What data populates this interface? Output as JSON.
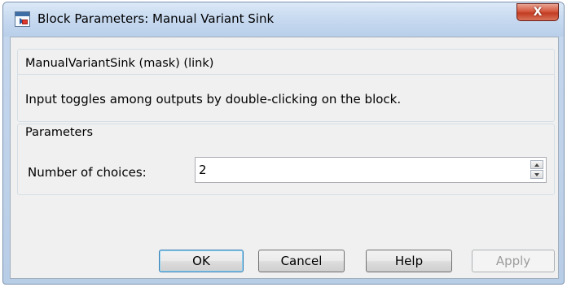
{
  "window": {
    "title": "Block Parameters: Manual Variant Sink",
    "close_symbol": "X"
  },
  "mask": {
    "title": "ManualVariantSink (mask) (link)",
    "description": "Input toggles among outputs by double-clicking on the block."
  },
  "parameters": {
    "title": "Parameters",
    "number_of_choices_label": "Number of choices:",
    "number_of_choices_value": "2"
  },
  "buttons": {
    "ok": "OK",
    "cancel": "Cancel",
    "help": "Help",
    "apply": "Apply"
  },
  "icons": {
    "app": "simulink-block-icon",
    "close": "close-icon",
    "spin_up": "chevron-up-icon",
    "spin_down": "chevron-down-icon"
  }
}
